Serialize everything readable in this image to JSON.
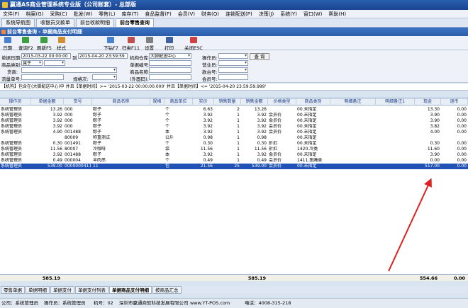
{
  "window": {
    "title": "赢通AS商业管理系统专业版（公司账套）- 总部版"
  },
  "menu": [
    "文件(F)",
    "档案(G)",
    "采购(C)",
    "批发(W)",
    "零售(L)",
    "库存(T)",
    "食品监督(F)",
    "会员(V)",
    "财务(Q)",
    "连锁配送(P)",
    "决策(J)",
    "系统(Y)",
    "窗口(W)",
    "帮助(H)"
  ],
  "window_tabs": [
    "系统导航图",
    "收银员交款单",
    "前台收款明细",
    "前台零售查询"
  ],
  "subtitle": "前台零售查询 - 单据商品支付明细",
  "toolbar": [
    "日期",
    "查询F2",
    "刷新F5",
    "样式",
    "下钻F7",
    "归类F11",
    "设置",
    "打印",
    "关闭ESC"
  ],
  "filters": {
    "date_label": "单据日期:",
    "date_from": "2015-03-22 00:00:00",
    "date_to_label": "到",
    "date_to": "2015-04-20 23:59:59",
    "warehouse_label": "机构仓库:",
    "warehouse": "大脚配送中心",
    "operator_label": "操作员:",
    "query_btn": "查 询",
    "category_label": "商品类别:",
    "category": "属于",
    "doc_no_label": "单据编号:",
    "salesperson_label": "营业员:",
    "supplier_label": "货商:",
    "product_name_label": "商品名称:",
    "cashier_label": "款台号:",
    "barcode_label": "流量单号:",
    "spec_label": "规格次:",
    "extra_label": "(外面码):",
    "member_label": "会员号:"
  },
  "condition": "【机构】包含在(大脚配送中心)中 并且【单据时间】>= '2015-03-22 00:00:00.000' 并且【单据时间】<= '2015-04-20 23:59:59.999'",
  "columns": [
    "操作员",
    "单据金额",
    "货号",
    "商品名称",
    "规格",
    "商品单位",
    "实价",
    "销售数量",
    "销售金额",
    "价格类型",
    "商品类别",
    "明细备注",
    "明细备注1",
    "现金",
    "退币"
  ],
  "rows": [
    [
      "系统管理员",
      "13.26",
      "000",
      "粽子",
      "",
      "个",
      "6.63",
      "2",
      "13.26",
      "",
      "00.未指定",
      "",
      "",
      "13.30",
      "0.00"
    ],
    [
      "系统管理员",
      "3.92",
      "000",
      "粽子",
      "",
      "个",
      "3.92",
      "1",
      "3.92",
      "会员价",
      "00.未指定",
      "",
      "",
      "3.90",
      "0.00"
    ],
    [
      "系统管理员",
      "3.92",
      "000",
      "粽子",
      "",
      "个",
      "3.92",
      "1",
      "3.92",
      "会员价",
      "00.未指定",
      "",
      "",
      "3.90",
      "0.00"
    ],
    [
      "系统管理员",
      "3.92",
      "000",
      "粽子",
      "",
      "个",
      "3.92",
      "1",
      "3.92",
      "会员价",
      "00.未指定",
      "",
      "",
      "3.82",
      "0.00"
    ],
    [
      "系统管理员",
      "4.90",
      "001488",
      "粽子",
      "",
      "本",
      "3.92",
      "1",
      "3.92",
      "会员价",
      "00.未指定",
      "",
      "",
      "4.00",
      "0.00"
    ],
    [
      "",
      "",
      "80009",
      "称重测试",
      "",
      "公斤",
      "0.98",
      "1",
      "0.98",
      "",
      "00.未指定",
      "",
      "",
      "",
      ""
    ],
    [
      "系统管理员",
      "0.30",
      "001491",
      "粽子",
      "",
      "个",
      "0.30",
      "1",
      "0.30",
      "折扣",
      "00.未指定",
      "",
      "",
      "0.30",
      "0.00"
    ],
    [
      "系统管理员",
      "11.56",
      "80007",
      "冷咖啡",
      "",
      "袋",
      "11.56",
      "1",
      "11.56",
      "折扣",
      "1420.冷类",
      "",
      "",
      "11.60",
      "0.00"
    ],
    [
      "系统管理员",
      "3.92",
      "001488",
      "粽子",
      "",
      "本",
      "3.92",
      "1",
      "3.92",
      "会员价",
      "00.未指定",
      "",
      "",
      "3.90",
      "0.00"
    ],
    [
      "系统管理员",
      "0.49",
      "000004",
      "羊肉串",
      "",
      "个",
      "0.49",
      "1",
      "0.49",
      "会员价",
      "1411.熏腌类",
      "",
      "",
      "0.00",
      "0.00"
    ],
    [
      "系统管理员",
      "539.00",
      "0000000411",
      "11",
      "",
      "包",
      "21.56",
      "25",
      "539.00",
      "会员价",
      "00.未指定",
      "",
      "",
      "517.00",
      "0.00"
    ]
  ],
  "selected_row": 10,
  "totals": {
    "amount": "585.19",
    "sales_amount": "585.19",
    "cash": "554.66",
    "refund": "0.00"
  },
  "bottom_tabs": [
    "零售单据",
    "单据明细",
    "单据支付",
    "单据支付列表",
    "单据商品支付明细",
    "按商品汇总"
  ],
  "active_bottom_tab": 4,
  "status": {
    "operator": "公司：系统管理员",
    "user": "操作员：系统管理员",
    "machine": "机号：02",
    "company": "深圳市赢通商软科技发展有限公司",
    "website": "www.YT-POS.com",
    "phone": "电话：4008-315-218"
  }
}
